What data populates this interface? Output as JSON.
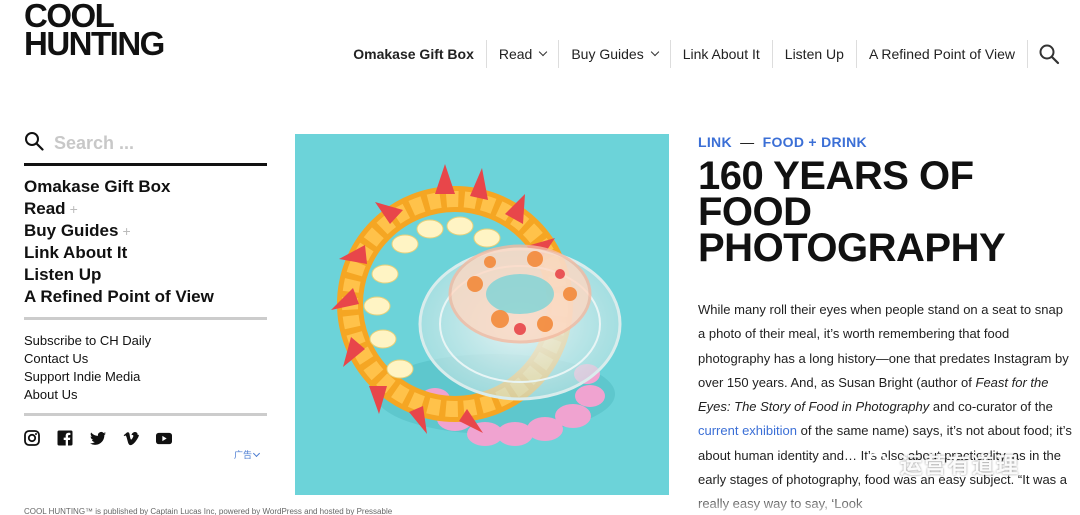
{
  "logo": {
    "line1": "COOL",
    "line2": "HUNTING"
  },
  "topnav": {
    "items": [
      {
        "label": "Omakase Gift Box"
      },
      {
        "label": "Read"
      },
      {
        "label": "Buy Guides"
      },
      {
        "label": "Link About It"
      },
      {
        "label": "Listen Up"
      },
      {
        "label": "A Refined Point of View"
      }
    ],
    "search_icon": "search-icon"
  },
  "sidebar": {
    "search_placeholder": "Search ...",
    "menu": [
      {
        "label": "Omakase Gift Box"
      },
      {
        "label": "Read",
        "expand": "+"
      },
      {
        "label": "Buy Guides",
        "expand": "+"
      },
      {
        "label": "Link About It"
      },
      {
        "label": "Listen Up"
      },
      {
        "label": "A Refined Point of View"
      }
    ],
    "links": [
      {
        "label": "Subscribe to CH Daily"
      },
      {
        "label": "Contact Us"
      },
      {
        "label": "Support Indie Media"
      },
      {
        "label": "About Us"
      }
    ],
    "social_icons": [
      "instagram-icon",
      "facebook-icon",
      "twitter-icon",
      "vimeo-icon",
      "youtube-icon"
    ],
    "ad_label": "广告"
  },
  "article": {
    "kicker_primary": "LINK",
    "kicker_dash": "—",
    "kicker_secondary": "FOOD + DRINK",
    "headline": "160 YEARS OF FOOD PHOTOGRAPHY",
    "body_1": "While many roll their eyes when people stand on a seat to snap a photo of their meal, it’s worth remembering that food photography has a long history—one that predates Instagram by over 150 years. And, as Susan Bright (author of ",
    "body_italic": "Feast for the Eyes: The Story of Food in Photography",
    "body_2": " and co-curator of the ",
    "body_link": "current exhibition",
    "body_3": " of the same name) says, it’s not about food; it’s about human identity and… It’s also about practicality, as in the early stages of photography, food was an easy subject. “It was a really easy way to say, ‘Look"
  },
  "footer": {
    "text": "COOL HUNTING™ is published by Captain Lucas Inc, powered by WordPress and hosted by Pressable"
  },
  "watermark": {
    "text": "运营有道理"
  },
  "colors": {
    "accent": "#3b6fd6",
    "hero_bg": "#6cd3d9"
  }
}
